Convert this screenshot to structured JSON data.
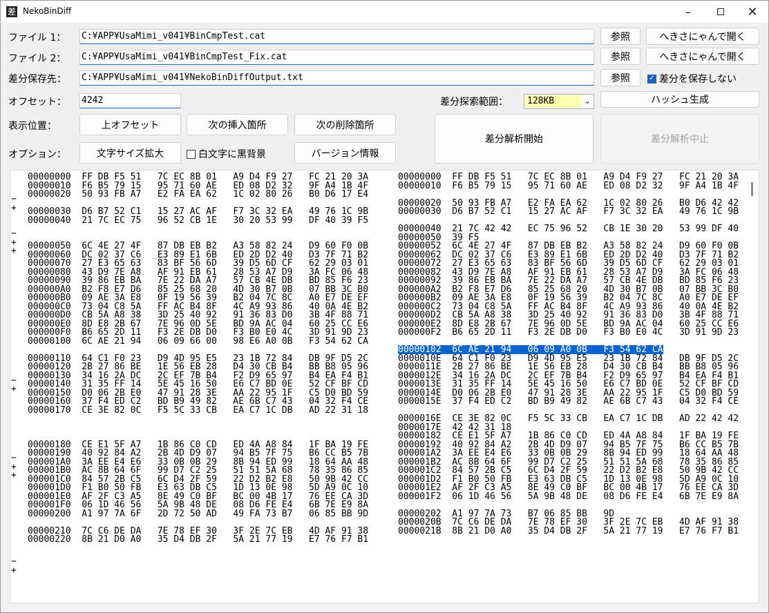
{
  "window": {
    "title": "NekoBinDiff",
    "icon_glyph": "差"
  },
  "file1": {
    "label": "ファイル 1：",
    "value": "C:¥APP¥UsaMimi_v041¥BinCmpTest.cat",
    "browse": "参照",
    "open": "へきさにゃんで開く"
  },
  "file2": {
    "label": "ファイル 2：",
    "value": "C:¥APP¥UsaMimi_v041¥BinCmpTest_Fix.cat",
    "browse": "参照",
    "open": "へきさにゃんで開く"
  },
  "output": {
    "label": "差分保存先：",
    "value": "C:¥APP¥UsaMimi_v041¥NekoBinDiffOutput.txt",
    "browse": "参照",
    "nosave_label": "差分を保存しない",
    "nosave_checked": true
  },
  "offset": {
    "label": "オフセット：",
    "value": "4242"
  },
  "range": {
    "label": "差分探索範囲：",
    "value": "128KB"
  },
  "hash_button": "ハッシュ生成",
  "position": {
    "label": "表示位置：",
    "up": "上オフセット",
    "next_insert": "次の挿入箇所",
    "next_delete": "次の削除箇所"
  },
  "start_button": "差分解析開始",
  "stop_button": "差分解析中止",
  "options": {
    "label": "オプション：",
    "font_up": "文字サイズ拡大",
    "white_on_black": "白文字に黒背景",
    "white_on_black_checked": false,
    "version": "バージョン情報"
  },
  "markers": [
    {
      "row": 2,
      "sym": "−"
    },
    {
      "row": 3,
      "sym": "+"
    },
    {
      "row": 6,
      "sym": "−"
    },
    {
      "row": 7,
      "sym": "+"
    },
    {
      "row": 8,
      "sym": "+"
    },
    {
      "row": 23,
      "sym": "−"
    },
    {
      "row": 24,
      "sym": "+"
    },
    {
      "row": 32,
      "sym": "−"
    },
    {
      "row": 33,
      "sym": "+"
    },
    {
      "row": 34,
      "sym": "+"
    },
    {
      "row": 44,
      "sym": "−"
    },
    {
      "row": 45,
      "sym": "+"
    }
  ],
  "left_rows": [
    "00000000  FF DB F5 51   7C EC 8B 01   A9 D4 F9 27   FC 21 20 3A",
    "00000010  F6 B5 79 15   95 71 60 AE   ED 08 D2 32   9F A4 1B 4F",
    "00000020  50 93 FB A7   E2 FA EA 62   1C 02 80 26   B0 D6 17 E4",
    "",
    "00000030  D6 B7 52 C1   15 27 AC AF   F7 3C 32 EA   49 76 1C 9B",
    "00000040  21 7C EC 75   96 52 CB 1E   30 20 53 99   DF 40 39 F5",
    "",
    "",
    "00000050  6C 4E 27 4F   87 DB EB B2   A3 58 82 24   D9 60 F0 0B",
    "00000060  DC 02 37 C6   E3 89 E1 6B   ED 2D D2 40   D3 7F 71 B2",
    "00000070  27 E3 65 63   83 BF 56 6D   39 D5 6D CF   62 29 03 01",
    "00000080  43 D9 7E A8   AF 91 EB 61   28 53 A7 D9   3A FC 06 48",
    "00000090  39 86 EB BA   7E 22 DA A7   57 CB 4E DB   BD 85 F6 23",
    "000000A0  B2 F8 E7 D6   85 25 68 20   4D 30 B7 0B   07 BB 3C B0",
    "000000B0  09 AE 3A E8   0F 19 56 39   B2 04 7C 8C   A0 E7 DE EF",
    "000000C0  73 04 C8 5A   FF AC B4 8F   4C A9 93 86   40 0A 4E B2",
    "000000D0  CB 5A A8 38   3D 25 40 92   91 36 83 D0   3B 4F 88 71",
    "000000E0  8D E8 2B 67   7E 96 0D 5E   BD 9A AC 04   60 25 CC E6",
    "000000F0  B6 65 2D 11   F3 2E DB D0   F3 B0 E0 4C   3D 91 9D 23",
    "00000100  6C AE 21 94   06 09 66 00   98 E6 A0 0B   F3 54 62 CA",
    "",
    "00000110  64 C1 F0 23   D9 4D 95 E5   23 1B 72 84   DB 9F D5 2C",
    "00000120  2B 27 86 BE   1E 56 EB 28   D4 30 CB B4   BB B8 05 96",
    "00000130  34 16 2A DC   2C EF 7B B4   F2 D9 65 97   B4 EA F4 B1",
    "00000140  31 35 FF 14   5E 45 16 50   E6 C7 BD 0E   52 CF BF CD",
    "00000150  D0 06 2B E0   47 91 28 3E   AA 22 95 1F   C5 D0 BD 59",
    "00000160  37 F4 ED C2   BD B9 49 82   AE 6B C7 43   04 32 F4 CE",
    "00000170  CE 3E 82 0C   F5 5C 33 CB   EA C7 1C DB   AD 22 31 18",
    "",
    "",
    "",
    "00000180  CE E1 5F A7   1B 86 C0 CD   ED 4A A8 84   1F BA 19 FE",
    "00000190  40 92 84 A2   2B 4D D9 07   94 B5 7F 75   B6 CC B5 7B",
    "000001A0  3A EE E4 E6   33 0B 0B 29   8B 94 ED 99   18 64 AA 48",
    "000001B0  AC 8B 64 6F   99 D7 C2 25   51 51 5A 68   78 35 86 85",
    "000001C0  84 57 2B C5   6C D4 2F 59   22 D2 B2 E8   50 9B 42 CC",
    "000001D0  F1 B0 50 FB   E3 63 DB C5   1D 13 0E 98   5D A9 0C 10",
    "000001E0  AF 2F C3 A5   8E 49 C0 BF   BC 00 4B 17   76 EE CA 3D",
    "000001F0  06 1D 46 56   5A 9B 48 DE   08 D6 FE E4   6B 7E E9 8A",
    "00000200  A1 97 7A 6F   2D 72 50 AD   49 FA 73 B7   06 85 BB 9D",
    "",
    "00000210  7C C6 DE DA   7E 78 EF 30   3F 2E 7C EB   4D AF 91 38",
    "00000220  8B 21 D0 A0   35 D4 DB 2F   5A 21 77 19   E7 76 F7 B1"
  ],
  "right_rows": [
    "00000000  FF DB F5 51   7C EC 8B 01   A9 D4 F9 27   FC 21 20 3A",
    "00000010  F6 B5 79 15   95 71 60 AE   ED 08 D2 32   9F A4 1B 4F",
    "",
    "00000020  50 93 FB A7   E2 FA EA 62   1C 02 80 26   B0 D6 42 42",
    "00000030  D6 B7 52 C1   15 27 AC AF   F7 3C 32 EA   49 76 1C 9B",
    "",
    "00000040  21 7C 42 42   EC 75 96 52   CB 1E 30 20   53 99 DF 40",
    "00000050  39 F5",
    "00000052  6C 4E 27 4F   87 DB EB B2   A3 58 82 24   D9 60 F0 0B",
    "00000062  DC 02 37 C6   E3 89 E1 6B   ED 2D D2 40   D3 7F 71 B2",
    "00000072  27 E3 65 63   83 BF 56 6D   39 D5 6D CF   62 29 03 01",
    "00000082  43 D9 7E A8   AF 91 EB 61   28 53 A7 D9   3A FC 06 48",
    "00000092  39 86 EB BA   7E 22 DA A7   57 CB 4E DB   BD 85 F6 23",
    "000000A2  B2 F8 E7 D6   85 25 68 20   4D 30 B7 0B   07 BB 3C B0",
    "000000B2  09 AE 3A E8   0F 19 56 39   B2 04 7C 8C   A0 E7 DE EF",
    "000000C2  73 04 C8 5A   FF AC B4 8F   4C A9 93 86   40 0A 4E B2",
    "000000D2  CB 5A A8 38   3D 25 40 92   91 36 83 D0   3B 4F 88 71",
    "000000E2  8D E8 2B 67   7E 96 0D 5E   BD 9A AC 04   60 25 CC E6",
    "000000F2  B6 65 2D 11   F3 2E DB D0   F3 B0 E0 4C   3D 91 9D 23",
    "",
    "00000102  6C AE 21 94   06 09 A0 0B   F3 54 62 CA",
    "0000010E  64 C1 F0 23   D9 4D 95 E5   23 1B 72 84   DB 9F D5 2C",
    "0000011E  2B 27 86 BE   1E 56 EB 28   D4 30 CB B4   BB B8 05 96",
    "0000012E  34 16 2A DC   2C EF 7B B4   F2 D9 65 97   B4 EA F4 B1",
    "0000013E  31 35 FF 14   5E 45 16 50   E6 C7 BD 0E   52 CF BF CD",
    "0000014E  D0 06 2B E0   47 91 28 3E   AA 22 95 1F   C5 D0 BD 59",
    "0000015E  37 F4 ED C2   BD B9 49 82   AE 6B C7 43   04 32 F4 CE",
    "",
    "0000016E  CE 3E 82 0C   F5 5C 33 CB   EA C7 1C DB   AD 22 42 42",
    "0000017E  42 42 31 18",
    "00000182  CE E1 5F A7   1B 86 C0 CD   ED 4A A8 84   1F BA 19 FE",
    "00000192  40 92 84 A2   2B 4D D9 07   94 B5 7F 75   B6 CC B5 7B",
    "000001A2  3A EE E4 E6   33 0B 0B 29   8B 94 ED 99   18 64 AA 48",
    "000001B2  AC 8B 64 6F   99 D7 C2 25   51 51 5A 68   78 35 86 85",
    "000001C2  84 57 2B C5   6C D4 2F 59   22 D2 B2 E8   50 9B 42 CC",
    "000001D2  F1 B0 50 FB   E3 63 DB C5   1D 13 0E 98   5D A9 0C 10",
    "000001E2  AF 2F C3 A5   8E 49 C0 BF   BC 00 4B 17   76 EE CA 3D",
    "000001F2  06 1D 46 56   5A 9B 48 DE   08 D6 FE E4   6B 7E E9 8A",
    "",
    "00000202  A1 97 7A 73   B7 06 85 BB   9D",
    "0000020B  7C C6 DE DA   7E 78 EF 30   3F 2E 7C EB   4D AF 91 38",
    "0000021B  8B 21 D0 A0   35 D4 DB 2F   5A 21 77 19   E7 76 F7 B1"
  ],
  "highlight_row": 20
}
